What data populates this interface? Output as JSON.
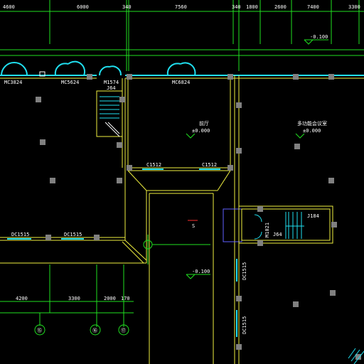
{
  "top_dimensions": [
    "4600",
    "6000",
    "340",
    "7560",
    "340",
    "1800",
    "2600",
    "7400",
    "3300"
  ],
  "bottom_dimensions": [
    "4200",
    "3300",
    "2000",
    "170"
  ],
  "axis_bubbles": [
    "⑮",
    "⑯",
    "⑰"
  ],
  "door_labels": {
    "mc3824": "MC3824",
    "mc5624": "MC5624",
    "m1574": "M1574",
    "j64_top": "J64",
    "mc6824": "MC6824",
    "m1021": "M1021",
    "j64_right": "J64",
    "j184": "J184"
  },
  "window_labels": {
    "c1512_left": "C1512",
    "c1512_right": "C1512",
    "dc1515_left": "DC1515",
    "dc1515_right": "DC1515",
    "dc1515_vert_top": "DC1515",
    "dc1515_vert_bottom": "DC1515"
  },
  "rooms": {
    "middle_name": "前厅",
    "middle_level": "±0.000",
    "right_name": "多功能会议室",
    "right_level": "±0.000"
  },
  "levels": {
    "top_right": "-0.100",
    "bottom_mid": "-0.100"
  },
  "center_mark": "S"
}
